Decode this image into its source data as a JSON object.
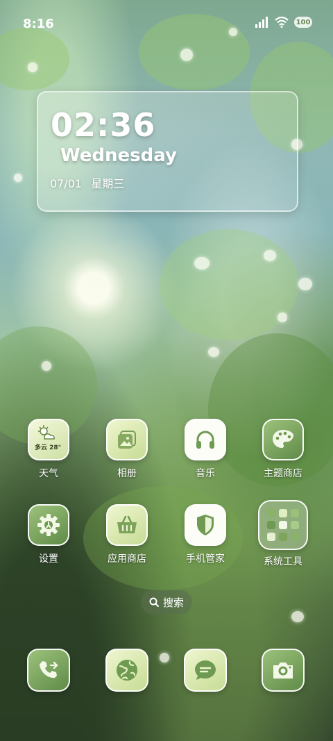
{
  "status_bar": {
    "time": "8:16",
    "battery": "100"
  },
  "clock_widget": {
    "time": "02:36",
    "weekday_en": "Wednesday",
    "date": "07/01",
    "weekday_cn": "星期三"
  },
  "apps_row1": [
    {
      "label": "天气",
      "icon": "weather-icon",
      "weather_text": "多云 28°"
    },
    {
      "label": "相册",
      "icon": "gallery-icon"
    },
    {
      "label": "音乐",
      "icon": "headphones-icon"
    },
    {
      "label": "主题商店",
      "icon": "palette-icon"
    }
  ],
  "apps_row2": [
    {
      "label": "设置",
      "icon": "gear-icon"
    },
    {
      "label": "应用商店",
      "icon": "basket-icon"
    },
    {
      "label": "手机管家",
      "icon": "shield-icon"
    },
    {
      "label": "系统工具",
      "icon": "folder-icon"
    }
  ],
  "search": {
    "label": "搜索"
  },
  "dock": [
    {
      "icon": "phone-icon"
    },
    {
      "icon": "browser-globe-icon"
    },
    {
      "icon": "message-icon"
    },
    {
      "icon": "camera-icon"
    }
  ],
  "colors": {
    "accent_green": "#6f9a52",
    "pale_green": "#e4f0c0",
    "white": "#fbfdf6"
  }
}
